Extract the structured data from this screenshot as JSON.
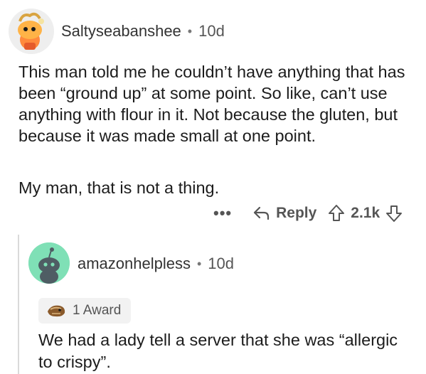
{
  "comment": {
    "username": "Saltyseabanshee",
    "separator": "•",
    "age": "10d",
    "paragraphs": [
      "This man told me he couldn’t have anything that has been “ground up” at some point. So like, can’t use anything with flour in it. Not because the gluten, but because it was made small at one point.",
      "My man, that is not a thing."
    ],
    "actions": {
      "more": "•••",
      "reply_label": "Reply",
      "score": "2.1k"
    }
  },
  "reply": {
    "username": "amazonhelpless",
    "separator": "•",
    "age": "10d",
    "award_label": "1 Award",
    "text": "We had a lady tell a server that she was “allergic to crispy”."
  },
  "colors": {
    "avatar2_bg": "#7fe0b6",
    "muted_text": "#555555"
  }
}
